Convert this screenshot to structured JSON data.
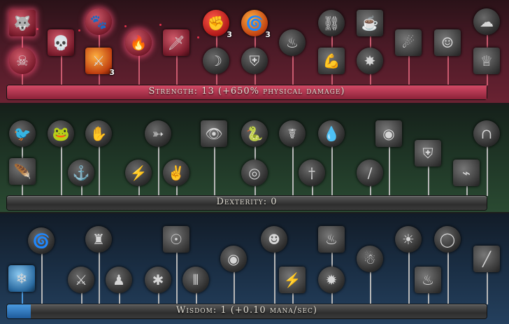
{
  "strength": {
    "label": "Strength: 13  (+650% physical damage)",
    "fill_fraction": 1.0,
    "nodes": [
      {
        "icon": "wolf-icon",
        "rank": ""
      },
      {
        "icon": "skull-icon",
        "rank": ""
      },
      {
        "icon": "skull-mask-icon",
        "rank": ""
      },
      {
        "icon": "wolf-howl-icon",
        "rank": ""
      },
      {
        "icon": "halberd-icon",
        "rank": "3"
      },
      {
        "icon": "flame-shield-icon",
        "rank": ""
      },
      {
        "icon": "dagger-icon",
        "rank": ""
      },
      {
        "icon": "fist-icon",
        "rank": "3"
      },
      {
        "icon": "shadow-claw-icon",
        "rank": ""
      },
      {
        "icon": "fire-swirl-icon",
        "rank": "3"
      },
      {
        "icon": "shield-icon",
        "rank": ""
      },
      {
        "icon": "dark-flame-icon",
        "rank": ""
      },
      {
        "icon": "chain-icon",
        "rank": ""
      },
      {
        "icon": "muscle-arm-icon",
        "rank": ""
      },
      {
        "icon": "cauldron-icon",
        "rank": ""
      },
      {
        "icon": "fire-orb-icon",
        "rank": ""
      },
      {
        "icon": "comet-icon",
        "rank": ""
      },
      {
        "icon": "stone-face-icon",
        "rank": ""
      },
      {
        "icon": "explosion-icon",
        "rank": ""
      },
      {
        "icon": "winged-icon",
        "rank": ""
      }
    ]
  },
  "dexterity": {
    "label": "Dexterity: 0",
    "nodes": [
      {
        "icon": "bird-icon"
      },
      {
        "icon": "feather-icon"
      },
      {
        "icon": "frog-icon"
      },
      {
        "icon": "hook-icon"
      },
      {
        "icon": "gauntlet-icon"
      },
      {
        "icon": "bolt-orb-icon"
      },
      {
        "icon": "bow-icon"
      },
      {
        "icon": "hand-icon"
      },
      {
        "icon": "cat-eyes-icon"
      },
      {
        "icon": "snake-icon"
      },
      {
        "icon": "target-icon"
      },
      {
        "icon": "serpent-icon"
      },
      {
        "icon": "blade-icon"
      },
      {
        "icon": "water-drop-icon"
      },
      {
        "icon": "sword-slash-icon"
      },
      {
        "icon": "dragon-eye-icon"
      },
      {
        "icon": "claw-shield-icon"
      },
      {
        "icon": "horseshoe-icon"
      },
      {
        "icon": "battery-icon"
      }
    ]
  },
  "wisdom": {
    "label": "Wisdom: 1  (+0.10 mana/sec)",
    "fill_fraction": 0.05,
    "nodes": [
      {
        "icon": "snowflake-icon"
      },
      {
        "icon": "vortex-icon"
      },
      {
        "icon": "crossed-swords-icon"
      },
      {
        "icon": "golem-icon"
      },
      {
        "icon": "hooded-figure-icon"
      },
      {
        "icon": "spider-icon"
      },
      {
        "icon": "eye-glow-icon"
      },
      {
        "icon": "claw-marks-icon"
      },
      {
        "icon": "eye-orb-icon"
      },
      {
        "icon": "mask-icon"
      },
      {
        "icon": "lightning-icon"
      },
      {
        "icon": "fire-column-icon"
      },
      {
        "icon": "burst-icon"
      },
      {
        "icon": "ghost-mask-icon"
      },
      {
        "icon": "sun-disc-icon"
      },
      {
        "icon": "fire-pit-icon"
      },
      {
        "icon": "ring-icon"
      },
      {
        "icon": "beam-icon"
      }
    ]
  },
  "colors": {
    "strength": "#6a2232",
    "dexterity": "#2a4a32",
    "wisdom": "#24405e",
    "str_fill": "#b2344e",
    "wis_fill": "#2a70c0"
  }
}
